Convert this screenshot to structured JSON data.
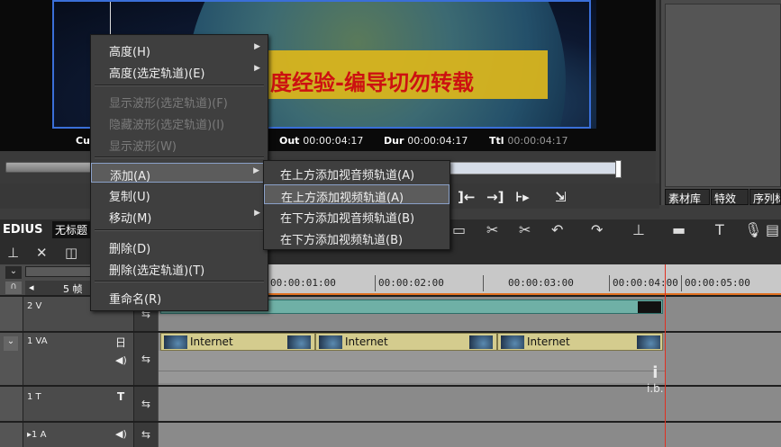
{
  "app": {
    "name": "EDIUS",
    "project_title": "无标题"
  },
  "preview": {
    "caption_text": "度经验-编导切勿转载",
    "cut_label": "Cu",
    "out_label": "Out",
    "out_value": "00:00:04:17",
    "dur_label": "Dur",
    "dur_value": "00:00:04:17",
    "ttl_label": "Ttl",
    "ttl_value": "00:00:04:17"
  },
  "right_panel": {
    "tabs": [
      "素材库",
      "特效",
      "序列标"
    ]
  },
  "context_menu": {
    "items": [
      {
        "label": "高度(H)",
        "disabled": false,
        "submenu": true
      },
      {
        "label": "高度(选定轨道)(E)",
        "disabled": false,
        "submenu": true
      },
      {
        "label": "显示波形(选定轨道)(F)",
        "disabled": true,
        "submenu": false
      },
      {
        "label": "隐藏波形(选定轨道)(I)",
        "disabled": true,
        "submenu": false
      },
      {
        "label": "显示波形(W)",
        "disabled": true,
        "submenu": false
      },
      {
        "label": "添加(A)",
        "disabled": false,
        "submenu": true,
        "highlighted": true
      },
      {
        "label": "复制(U)",
        "disabled": false,
        "submenu": false
      },
      {
        "label": "移动(M)",
        "disabled": false,
        "submenu": true
      },
      {
        "label": "删除(D)",
        "disabled": false,
        "submenu": false
      },
      {
        "label": "删除(选定轨道)(T)",
        "disabled": false,
        "submenu": false
      },
      {
        "label": "重命名(R)",
        "disabled": false,
        "submenu": false
      }
    ]
  },
  "submenu": {
    "items": [
      {
        "label": "在上方添加视音频轨道(A)"
      },
      {
        "label": "在上方添加视频轨道(A)",
        "highlighted": true
      },
      {
        "label": "在下方添加视音频轨道(B)"
      },
      {
        "label": "在下方添加视频轨道(B)"
      }
    ]
  },
  "timeline": {
    "scale_label": "5 帧",
    "ruler_ticks": [
      "00:00:01:00",
      "00:00:02:00",
      "00:00:03:00",
      "00:00:04:00",
      "00:00:05:00"
    ],
    "tracks": [
      {
        "name": "2 V",
        "type": "video"
      },
      {
        "name": "1 VA",
        "type": "video-audio"
      },
      {
        "name": "1 T",
        "type": "title"
      },
      {
        "name": "1 A",
        "type": "audio"
      }
    ],
    "clips": [
      {
        "track": "1 VA",
        "name": "Internet"
      },
      {
        "track": "1 VA",
        "name": "Internet"
      },
      {
        "track": "1 VA",
        "name": "Internet"
      }
    ],
    "playhead_color": "#e03020",
    "track_clip_color": "#6fb0a6",
    "audio_clip_color": "#d4cc8e"
  },
  "watermark": {
    "glyph": "i",
    "text": "i.b."
  }
}
